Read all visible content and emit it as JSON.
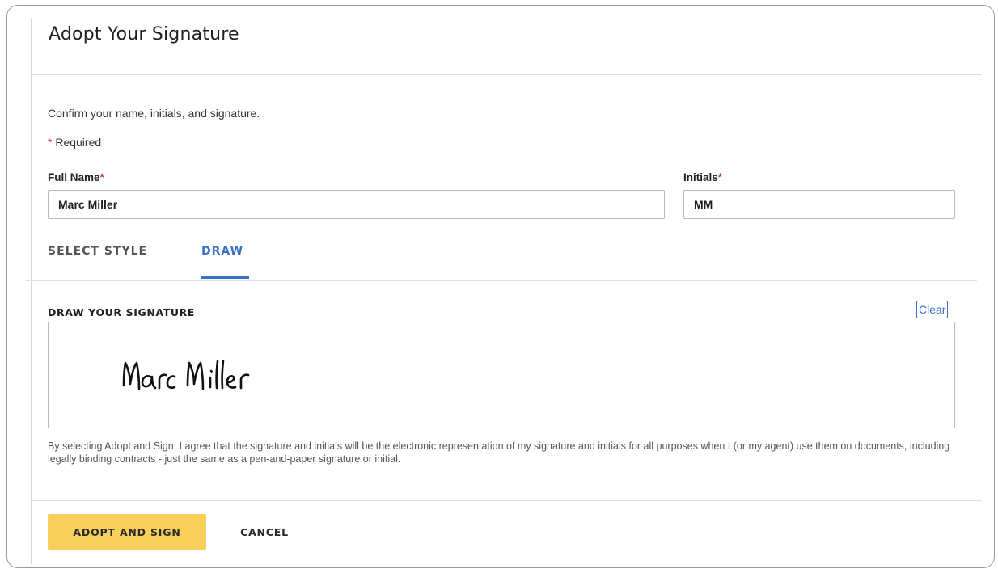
{
  "dialog": {
    "title": "Adopt Your Signature",
    "confirm_text": "Confirm your name, initials, and signature.",
    "required_marker": "*",
    "required_text": " Required"
  },
  "fields": {
    "full_name_label": "Full Name",
    "full_name_value": "Marc Miller",
    "initials_label": "Initials",
    "initials_value": "MM",
    "required_star": "*"
  },
  "tabs": [
    {
      "label": "SELECT STYLE",
      "active": false
    },
    {
      "label": "DRAW",
      "active": true
    }
  ],
  "draw": {
    "label": "DRAW YOUR SIGNATURE",
    "clear_label": "Clear",
    "signature_text": "Marc Miller"
  },
  "legal_text": "By selecting Adopt and Sign, I agree that the signature and initials will be the electronic representation of my signature and initials for all purposes when I (or my agent) use them on documents, including legally binding contracts - just the same as a pen-and-paper signature or initial.",
  "buttons": {
    "adopt_label": "ADOPT AND SIGN",
    "cancel_label": "CANCEL"
  },
  "colors": {
    "accent": "#3b72c9",
    "primary_button": "#f8cf5a",
    "required": "#c0392b"
  }
}
